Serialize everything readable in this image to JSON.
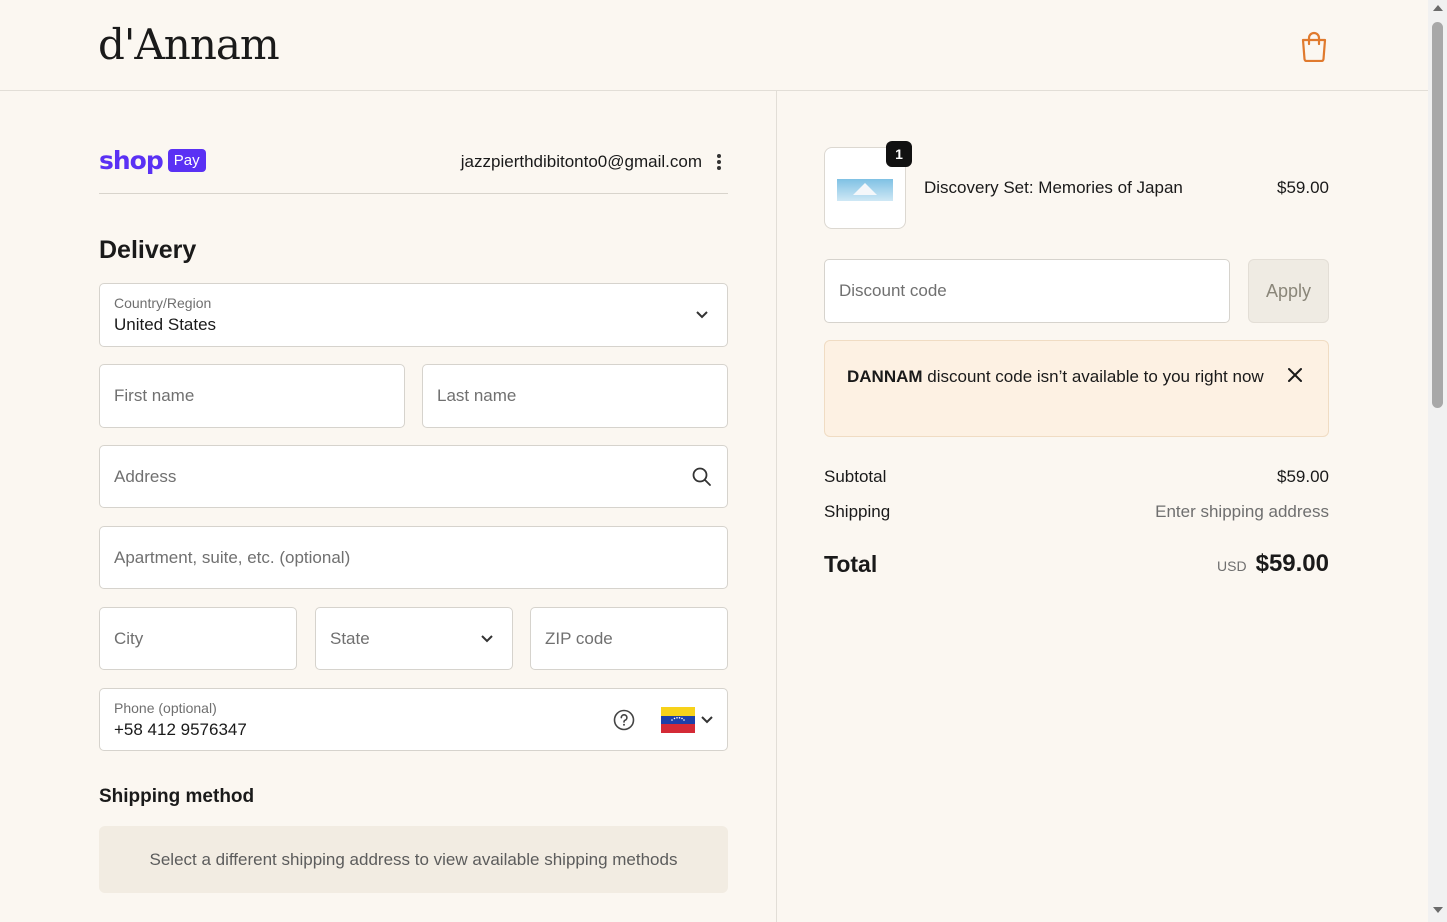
{
  "header": {
    "logo": "d'Annam",
    "cart_icon": "shopping-bag-icon",
    "accent": "#e07a2e"
  },
  "shop_pay": {
    "brand": "shop",
    "pill": "Pay",
    "email": "jazzpierthdibitonto0@gmail.com",
    "brand_color": "#5a31f4"
  },
  "delivery": {
    "title": "Delivery",
    "country": {
      "label": "Country/Region",
      "value": "United States"
    },
    "first_name_placeholder": "First name",
    "last_name_placeholder": "Last name",
    "address_placeholder": "Address",
    "apartment_placeholder": "Apartment, suite, etc. (optional)",
    "city_placeholder": "City",
    "state_placeholder": "State",
    "zip_placeholder": "ZIP code",
    "phone": {
      "label": "Phone (optional)",
      "value": "+58 412 9576347",
      "flag": "venezuela-flag"
    }
  },
  "shipping_method": {
    "title": "Shipping method",
    "message": "Select a different shipping address to view available shipping methods"
  },
  "order": {
    "item": {
      "name": "Discovery Set: Memories of Japan",
      "price": "$59.00",
      "quantity": "1"
    },
    "discount_placeholder": "Discount code",
    "apply_label": "Apply",
    "alert": {
      "code": "DANNAM",
      "message": " discount code isn’t available to you right now"
    },
    "subtotal_label": "Subtotal",
    "subtotal_value": "$59.00",
    "shipping_label": "Shipping",
    "shipping_value": "Enter shipping address",
    "total_label": "Total",
    "currency": "USD",
    "total_value": "$59.00"
  }
}
